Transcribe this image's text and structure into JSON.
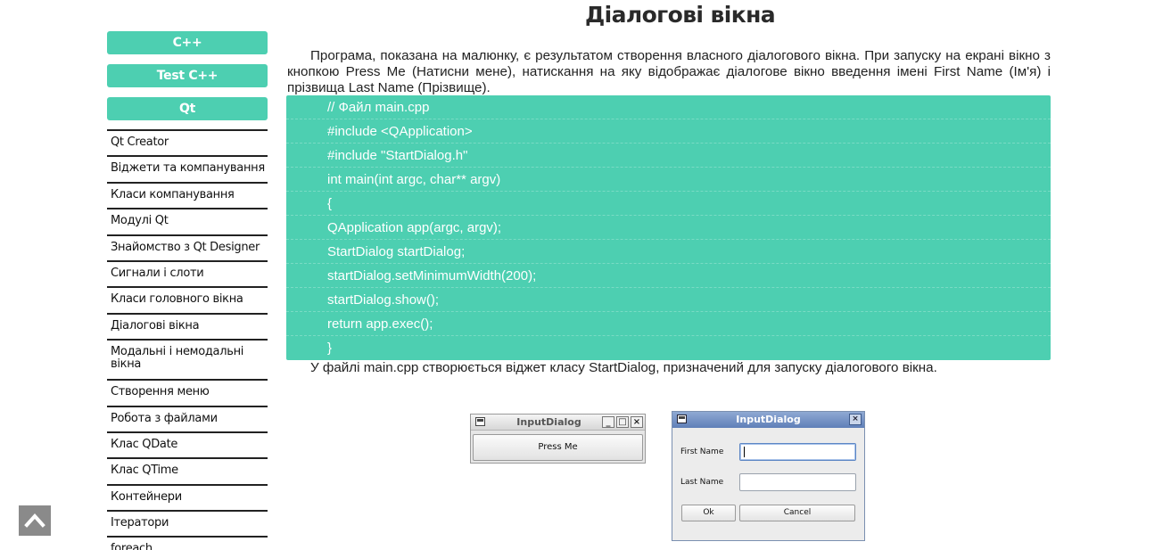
{
  "page": {
    "title": "Діалогові вікна"
  },
  "sidebar": {
    "buttons": [
      "C++",
      "Test C++",
      "Qt"
    ],
    "items": [
      "Qt Creator",
      "Віджети та компанування",
      "Класи компанування",
      "Модулі Qt",
      "Знайомство з Qt Designer",
      "Сигнали і слоти",
      "Класи головного вікна",
      "Діалогові вікна",
      "Модальні і немодальні вікна",
      "Створення меню",
      "Робота з файлами",
      "Клас QDate",
      "Клас QTime",
      "Контейнери",
      "Ітератори",
      "foreach"
    ]
  },
  "content": {
    "intro": "Програма, показана на малюнку, є результатом створення власного діалогового вікна. При запуску на екрані вікно з кнопкою Press Me (Натисни мене), натискання на яку відображає діалогове вікно введення імені First Name (Ім'я) і прізвища Last Name (Прізвище).",
    "code": [
      "// Файл main.cpp",
      "#include <QApplication>",
      "#include \"StartDialog.h\"",
      "int main(int argc, char** argv)",
      "{",
      "QApplication app(argc, argv);",
      "StartDialog startDialog;",
      "startDialog.setMinimumWidth(200);",
      "startDialog.show();",
      "return app.exec();",
      "}"
    ],
    "after_code": "У файлі main.cpp створюється віджет класу StartDialog, призначений для запуску діалогового вікна."
  },
  "screenshot": {
    "window1": {
      "title": "InputDialog",
      "button": "Press Me"
    },
    "window2": {
      "title": "InputDialog",
      "first_name_label": "First Name",
      "last_name_label": "Last Name",
      "ok_label": "Ok",
      "cancel_label": "Cancel"
    }
  },
  "icons": {
    "scroll_top": "chevron-up-icon"
  },
  "colors": {
    "accent": "#4dcfb1",
    "scroll_button": "#8a8a8a"
  }
}
